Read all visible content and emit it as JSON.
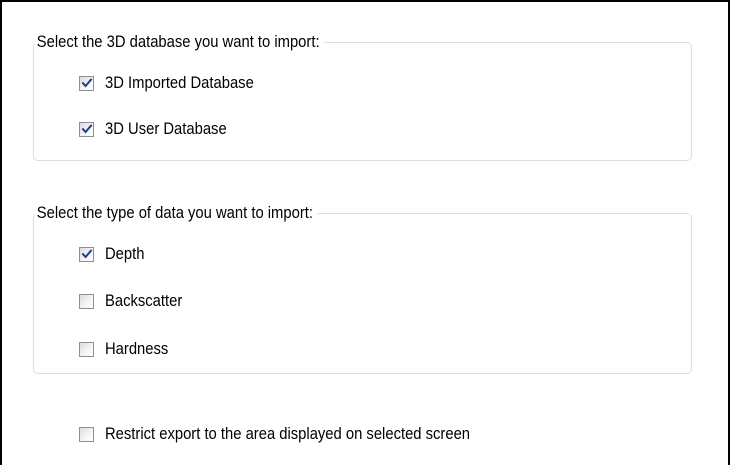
{
  "database_group": {
    "legend": "Select the 3D database you want to import:",
    "options": [
      {
        "label": "3D Imported Database",
        "checked": true
      },
      {
        "label": "3D User Database",
        "checked": true
      }
    ]
  },
  "data_type_group": {
    "legend": "Select the type of data you want to import:",
    "options": [
      {
        "label": "Depth",
        "checked": true
      },
      {
        "label": "Backscatter",
        "checked": false
      },
      {
        "label": "Hardness",
        "checked": false
      }
    ]
  },
  "restrict_export": {
    "label": "Restrict export to the area displayed on selected screen",
    "checked": false
  },
  "colors": {
    "checkmark": "#1c3f94",
    "group_border": "#d5dfe5",
    "checkbox_border": "#8e8f8f"
  }
}
